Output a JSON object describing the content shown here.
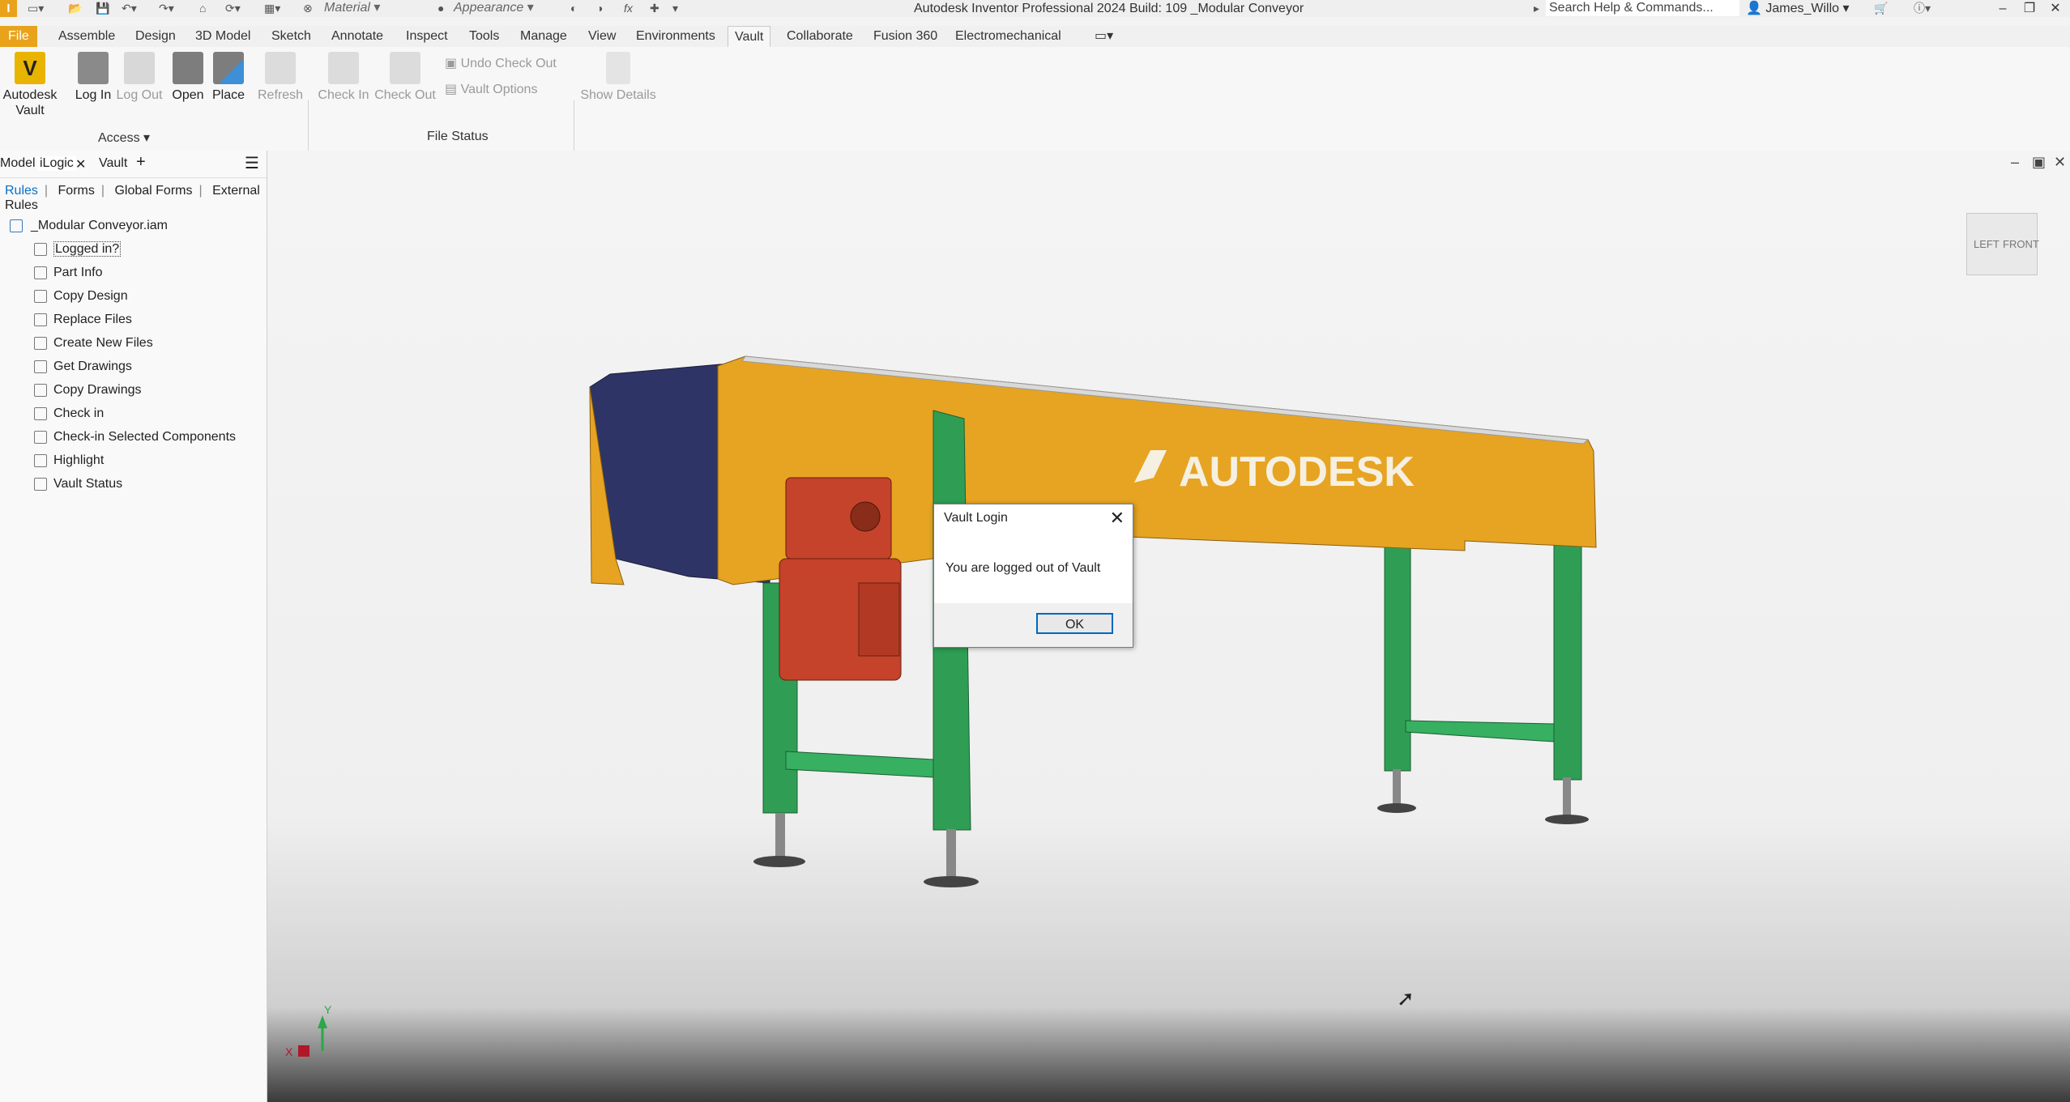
{
  "titlebar": {
    "app_letter": "I",
    "material": "Material",
    "appearance": "Appearance",
    "title": "Autodesk Inventor Professional 2024 Build: 109  _Modular Conveyor",
    "search_placeholder": "Search Help & Commands...",
    "user": "James_Willo"
  },
  "menu": {
    "tabs": [
      "File",
      "Assemble",
      "Design",
      "3D Model",
      "Sketch",
      "Annotate",
      "Inspect",
      "Tools",
      "Manage",
      "View",
      "Environments",
      "Vault",
      "Collaborate",
      "Fusion 360",
      "Electromechanical"
    ],
    "active": "Vault"
  },
  "ribbon": {
    "access": {
      "autodesk_vault": "Autodesk Vault",
      "log_in": "Log In",
      "log_out": "Log Out",
      "open": "Open",
      "place": "Place",
      "panel_label": "Access"
    },
    "file_status": {
      "refresh": "Refresh",
      "check_in": "Check In",
      "check_out": "Check Out",
      "undo_check_out": "Undo Check Out",
      "vault_options": "Vault Options",
      "show_details": "Show Details",
      "panel_label": "File Status"
    }
  },
  "browser": {
    "tabs": [
      "Model",
      "iLogic",
      "Vault"
    ],
    "subtabs": [
      "Rules",
      "Forms",
      "Global Forms",
      "External Rules"
    ],
    "root": "_Modular Conveyor.iam",
    "rules": [
      "Logged in?",
      "Part Info",
      "Copy Design",
      "Replace Files",
      "Create New Files",
      "Get Drawings",
      "Copy Drawings",
      "Check in",
      "Check-in Selected Components",
      "Highlight",
      "Vault Status"
    ]
  },
  "viewport": {
    "viewcube_left": "LEFT",
    "viewcube_front": "FRONT",
    "brand_text": "AUTODESK",
    "axis_x": "X",
    "axis_y": "Y"
  },
  "dialog": {
    "title": "Vault Login",
    "message": "You are logged out of Vault",
    "ok": "OK"
  },
  "colors": {
    "file_tab": "#e8a31b",
    "frame_yellow": "#e6a422",
    "legs_green": "#2f9e54",
    "motor_red": "#c4432a",
    "hopper_blue": "#2e3566"
  }
}
